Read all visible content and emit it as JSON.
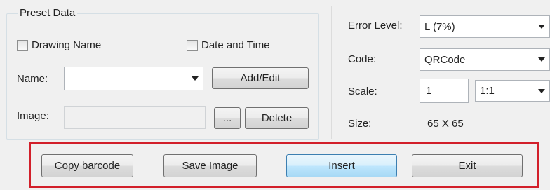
{
  "preset_group": {
    "title": "Preset Data"
  },
  "checkboxes": {
    "drawing_name": "Drawing Name",
    "date_time": "Date and Time"
  },
  "name_field": {
    "label": "Name:",
    "value": ""
  },
  "add_edit_button": "Add/Edit",
  "image_field": {
    "label": "Image:",
    "value": ""
  },
  "browse_button": "...",
  "delete_button": "Delete",
  "right_panel": {
    "error_level": {
      "label": "Error Level:",
      "value": "L (7%)"
    },
    "code": {
      "label": "Code:",
      "value": "QRCode"
    },
    "scale": {
      "label": "Scale:",
      "value": "1",
      "ratio": "1:1"
    },
    "size": {
      "label": "Size:",
      "value": "65 X 65"
    }
  },
  "bottom_buttons": {
    "copy_barcode": "Copy barcode",
    "save_image": "Save Image",
    "insert": "Insert",
    "exit": "Exit"
  },
  "colors": {
    "highlight_frame": "#d21f2a",
    "primary_button_border": "#3c7fb1"
  },
  "icons": {
    "dropdown": "chevron-down-icon"
  }
}
